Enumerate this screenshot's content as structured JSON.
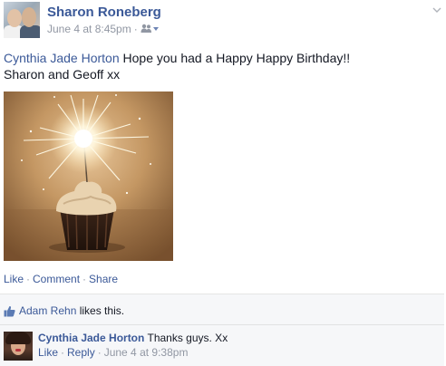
{
  "post": {
    "author": "Sharon Roneberg",
    "timestamp": "June 4 at 8:45pm",
    "separator": "·",
    "audience_icon": "friends-icon",
    "options_icon": "chevron-down-icon",
    "mention": "Cynthia Jade Horton",
    "message_line1": "Hope you had a Happy Happy Birthday!!",
    "message_line2": "Sharon and Geoff xx",
    "photo_alt": "cupcake with lit sparkler"
  },
  "actions": {
    "like": "Like",
    "comment": "Comment",
    "share": "Share",
    "separator": "·"
  },
  "likes": {
    "icon": "thumbs-up-icon",
    "liker": "Adam Rehn",
    "suffix": "likes this."
  },
  "comment": {
    "author": "Cynthia Jade Horton",
    "text": "Thanks guys. Xx",
    "like": "Like",
    "reply": "Reply",
    "timestamp": "June 4 at 9:38pm",
    "separator": "·"
  },
  "colors": {
    "link": "#3b5998",
    "meta": "#9197a3",
    "text": "#141823",
    "ufi_background": "#f6f7f9"
  }
}
